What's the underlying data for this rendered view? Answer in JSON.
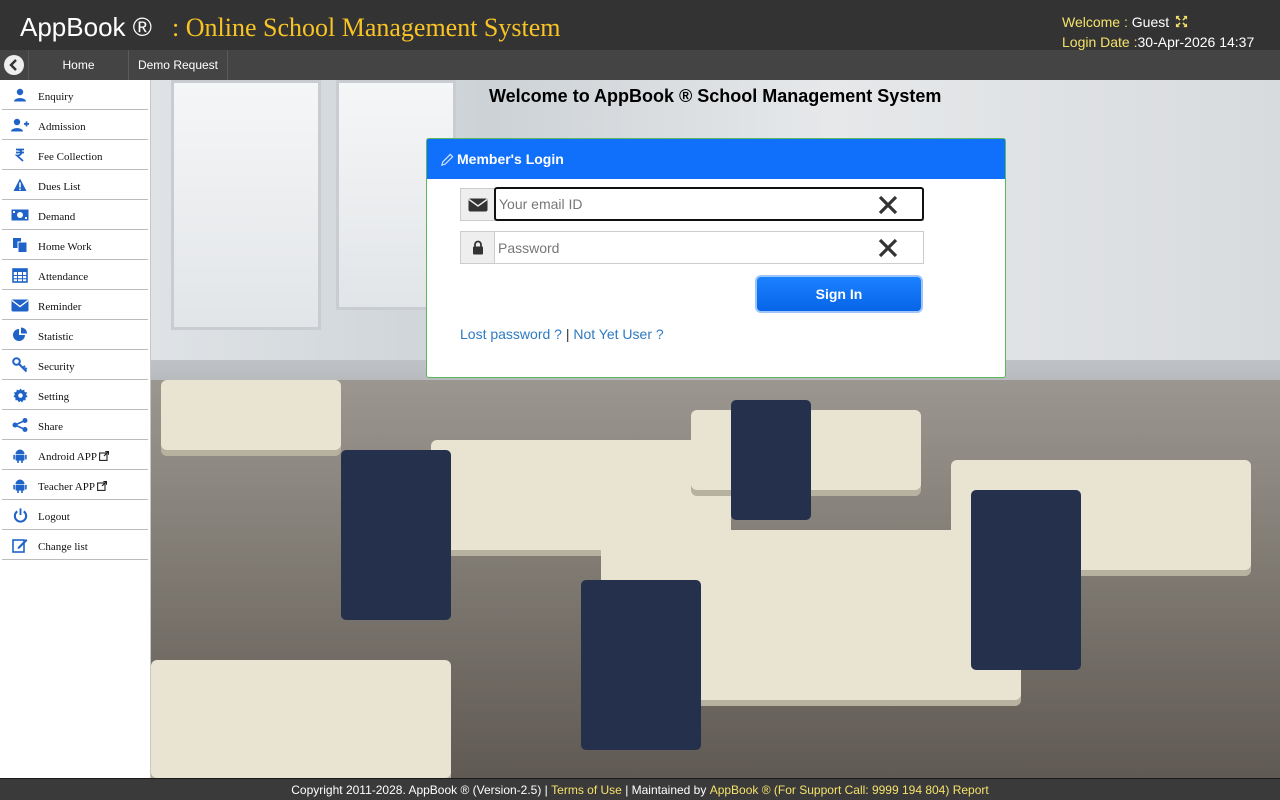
{
  "header": {
    "brand": "AppBook ®",
    "subtitle": ": Online School Management System",
    "welcome_label": "Welcome :",
    "welcome_user": "Guest",
    "login_date_label": "Login Date :",
    "login_date_value": "30-Apr-2026 14:37"
  },
  "nav": {
    "tabs": [
      {
        "label": "Home"
      },
      {
        "label": "Demo Request"
      }
    ]
  },
  "sidebar": {
    "items": [
      {
        "label": "Enquiry",
        "icon": "user-icon"
      },
      {
        "label": "Admission",
        "icon": "user-plus-icon"
      },
      {
        "label": "Fee Collection",
        "icon": "rupee-icon"
      },
      {
        "label": "Dues List",
        "icon": "warning-icon"
      },
      {
        "label": "Demand",
        "icon": "money-icon"
      },
      {
        "label": "Home Work",
        "icon": "files-icon"
      },
      {
        "label": "Attendance",
        "icon": "calendar-icon"
      },
      {
        "label": "Reminder",
        "icon": "envelope-icon"
      },
      {
        "label": "Statistic",
        "icon": "pie-chart-icon"
      },
      {
        "label": "Security",
        "icon": "key-icon"
      },
      {
        "label": "Setting",
        "icon": "gear-icon"
      },
      {
        "label": "Share",
        "icon": "share-icon"
      },
      {
        "label": "Android APP",
        "icon": "android-icon"
      },
      {
        "label": "Teacher APP",
        "icon": "android-icon"
      },
      {
        "label": "Logout",
        "icon": "power-icon"
      },
      {
        "label": "Change list",
        "icon": "edit-icon"
      }
    ]
  },
  "main": {
    "welcome_title": "Welcome to AppBook ® School Management System"
  },
  "login": {
    "title": "Member's Login",
    "email_placeholder": "Your email ID",
    "email_value": "",
    "password_placeholder": "Password",
    "password_value": "",
    "signin_label": "Sign In",
    "lost_password": "Lost password ?",
    "separator": "|",
    "not_yet_user": "Not Yet User ?"
  },
  "footer": {
    "copyright": "Copyright 2011-2028. AppBook ® (Version-2.5) |",
    "terms": "Terms of Use",
    "maintained": "| Maintained by",
    "support": "AppBook ® (For Support Call: 9999 194 804)",
    "report": "Report"
  },
  "colors": {
    "header_bg": "#333333",
    "accent_yellow": "#f7c325",
    "login_header": "#1070fb",
    "link": "#2e7ac0"
  }
}
